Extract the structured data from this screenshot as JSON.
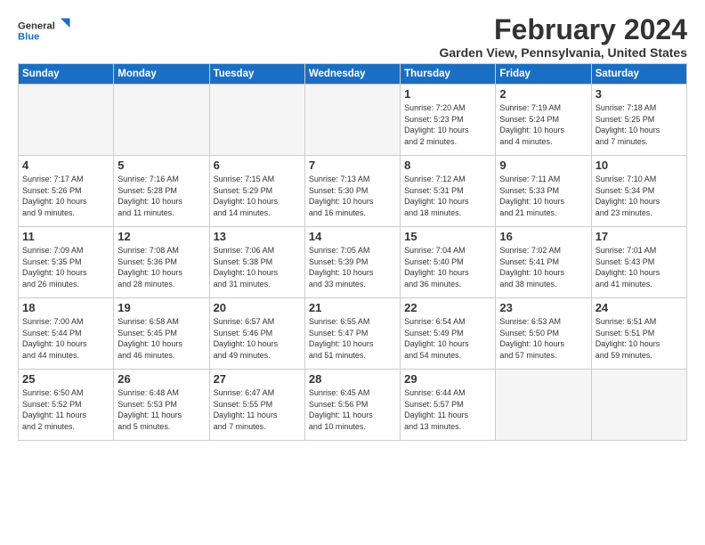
{
  "logo": {
    "line1": "General",
    "line2": "Blue"
  },
  "title": "February 2024",
  "subtitle": "Garden View, Pennsylvania, United States",
  "days_of_week": [
    "Sunday",
    "Monday",
    "Tuesday",
    "Wednesday",
    "Thursday",
    "Friday",
    "Saturday"
  ],
  "weeks": [
    [
      {
        "day": "",
        "info": ""
      },
      {
        "day": "",
        "info": ""
      },
      {
        "day": "",
        "info": ""
      },
      {
        "day": "",
        "info": ""
      },
      {
        "day": "1",
        "info": "Sunrise: 7:20 AM\nSunset: 5:23 PM\nDaylight: 10 hours\nand 2 minutes."
      },
      {
        "day": "2",
        "info": "Sunrise: 7:19 AM\nSunset: 5:24 PM\nDaylight: 10 hours\nand 4 minutes."
      },
      {
        "day": "3",
        "info": "Sunrise: 7:18 AM\nSunset: 5:25 PM\nDaylight: 10 hours\nand 7 minutes."
      }
    ],
    [
      {
        "day": "4",
        "info": "Sunrise: 7:17 AM\nSunset: 5:26 PM\nDaylight: 10 hours\nand 9 minutes."
      },
      {
        "day": "5",
        "info": "Sunrise: 7:16 AM\nSunset: 5:28 PM\nDaylight: 10 hours\nand 11 minutes."
      },
      {
        "day": "6",
        "info": "Sunrise: 7:15 AM\nSunset: 5:29 PM\nDaylight: 10 hours\nand 14 minutes."
      },
      {
        "day": "7",
        "info": "Sunrise: 7:13 AM\nSunset: 5:30 PM\nDaylight: 10 hours\nand 16 minutes."
      },
      {
        "day": "8",
        "info": "Sunrise: 7:12 AM\nSunset: 5:31 PM\nDaylight: 10 hours\nand 18 minutes."
      },
      {
        "day": "9",
        "info": "Sunrise: 7:11 AM\nSunset: 5:33 PM\nDaylight: 10 hours\nand 21 minutes."
      },
      {
        "day": "10",
        "info": "Sunrise: 7:10 AM\nSunset: 5:34 PM\nDaylight: 10 hours\nand 23 minutes."
      }
    ],
    [
      {
        "day": "11",
        "info": "Sunrise: 7:09 AM\nSunset: 5:35 PM\nDaylight: 10 hours\nand 26 minutes."
      },
      {
        "day": "12",
        "info": "Sunrise: 7:08 AM\nSunset: 5:36 PM\nDaylight: 10 hours\nand 28 minutes."
      },
      {
        "day": "13",
        "info": "Sunrise: 7:06 AM\nSunset: 5:38 PM\nDaylight: 10 hours\nand 31 minutes."
      },
      {
        "day": "14",
        "info": "Sunrise: 7:05 AM\nSunset: 5:39 PM\nDaylight: 10 hours\nand 33 minutes."
      },
      {
        "day": "15",
        "info": "Sunrise: 7:04 AM\nSunset: 5:40 PM\nDaylight: 10 hours\nand 36 minutes."
      },
      {
        "day": "16",
        "info": "Sunrise: 7:02 AM\nSunset: 5:41 PM\nDaylight: 10 hours\nand 38 minutes."
      },
      {
        "day": "17",
        "info": "Sunrise: 7:01 AM\nSunset: 5:43 PM\nDaylight: 10 hours\nand 41 minutes."
      }
    ],
    [
      {
        "day": "18",
        "info": "Sunrise: 7:00 AM\nSunset: 5:44 PM\nDaylight: 10 hours\nand 44 minutes."
      },
      {
        "day": "19",
        "info": "Sunrise: 6:58 AM\nSunset: 5:45 PM\nDaylight: 10 hours\nand 46 minutes."
      },
      {
        "day": "20",
        "info": "Sunrise: 6:57 AM\nSunset: 5:46 PM\nDaylight: 10 hours\nand 49 minutes."
      },
      {
        "day": "21",
        "info": "Sunrise: 6:55 AM\nSunset: 5:47 PM\nDaylight: 10 hours\nand 51 minutes."
      },
      {
        "day": "22",
        "info": "Sunrise: 6:54 AM\nSunset: 5:49 PM\nDaylight: 10 hours\nand 54 minutes."
      },
      {
        "day": "23",
        "info": "Sunrise: 6:53 AM\nSunset: 5:50 PM\nDaylight: 10 hours\nand 57 minutes."
      },
      {
        "day": "24",
        "info": "Sunrise: 6:51 AM\nSunset: 5:51 PM\nDaylight: 10 hours\nand 59 minutes."
      }
    ],
    [
      {
        "day": "25",
        "info": "Sunrise: 6:50 AM\nSunset: 5:52 PM\nDaylight: 11 hours\nand 2 minutes."
      },
      {
        "day": "26",
        "info": "Sunrise: 6:48 AM\nSunset: 5:53 PM\nDaylight: 11 hours\nand 5 minutes."
      },
      {
        "day": "27",
        "info": "Sunrise: 6:47 AM\nSunset: 5:55 PM\nDaylight: 11 hours\nand 7 minutes."
      },
      {
        "day": "28",
        "info": "Sunrise: 6:45 AM\nSunset: 5:56 PM\nDaylight: 11 hours\nand 10 minutes."
      },
      {
        "day": "29",
        "info": "Sunrise: 6:44 AM\nSunset: 5:57 PM\nDaylight: 11 hours\nand 13 minutes."
      },
      {
        "day": "",
        "info": ""
      },
      {
        "day": "",
        "info": ""
      }
    ]
  ]
}
